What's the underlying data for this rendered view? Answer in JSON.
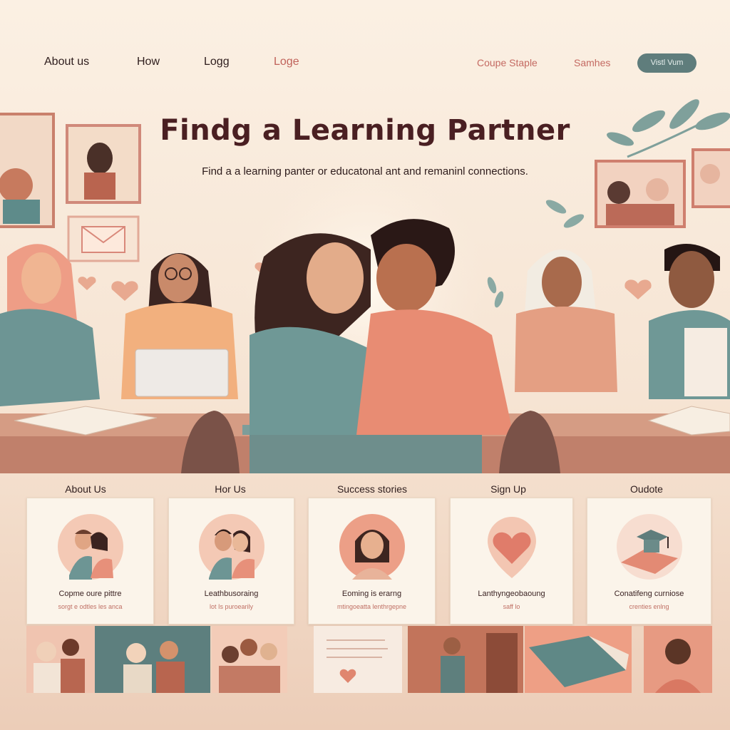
{
  "nav": {
    "links": [
      "About us",
      "How",
      "Logg",
      "Loge"
    ],
    "right_links": [
      "Coupe Staple",
      "Samhes"
    ],
    "cta_label": "Vistl Vum"
  },
  "hero": {
    "title": "Findg a Learning Partner",
    "subtitle": "Find a a learning panter or educatonal ant and remaninl connections."
  },
  "sections": {
    "labels": [
      "About Us",
      "Hor Us",
      "Success stories",
      "Sign Up",
      "Oudote"
    ],
    "cards": [
      {
        "title": "Copme oure pittre",
        "caption": "sorgt e odtles les anca",
        "icon": "couple-icon"
      },
      {
        "title": "Leathbusoraing",
        "caption": "lot Is puroearily",
        "icon": "couple-icon"
      },
      {
        "title": "Eoming is erarng",
        "caption": "mtingoeatta lenthrgepne",
        "icon": "person-icon"
      },
      {
        "title": "Lanthyngeobaoung",
        "caption": "saff lo",
        "icon": "heart-icon"
      },
      {
        "title": "Conatifeng curniose",
        "caption": "crenties enlng",
        "icon": "graduation-cap-icon"
      }
    ]
  },
  "colors": {
    "accent": "#c0625a",
    "teal": "#5f7d7c",
    "background": "#fbf0e3",
    "title": "#4a1f22"
  }
}
